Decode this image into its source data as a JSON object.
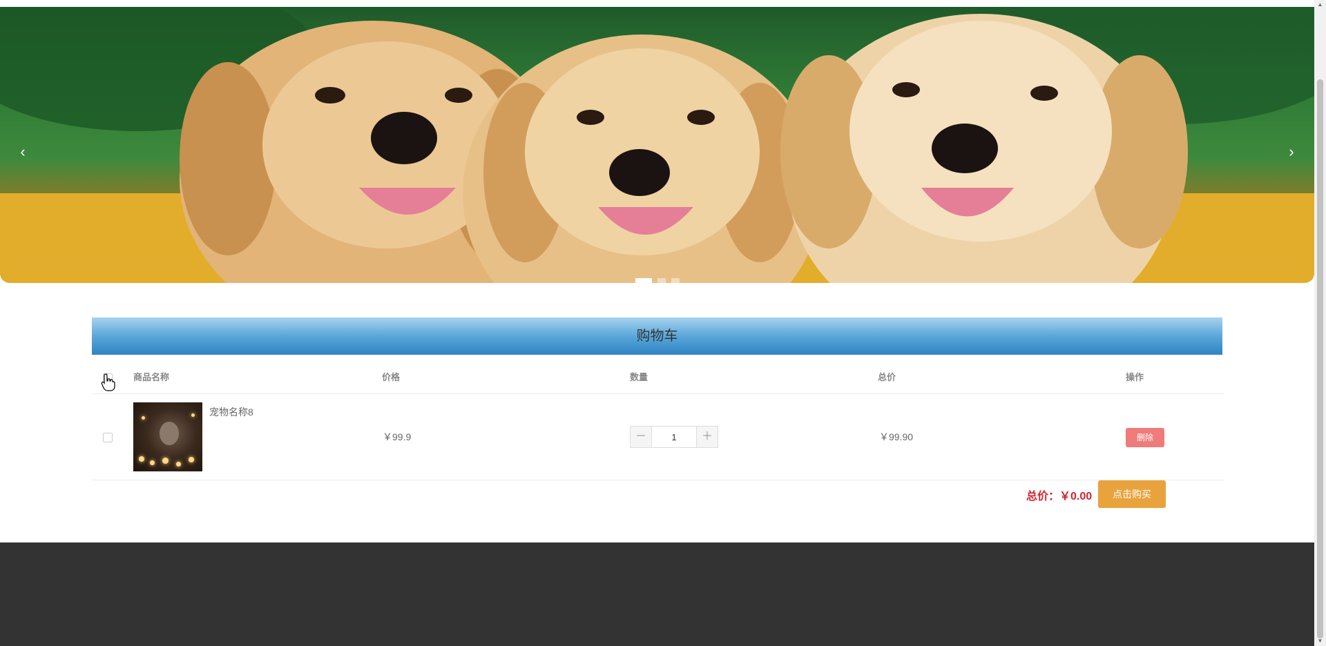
{
  "carousel": {
    "prev_icon": "chevron-left-icon",
    "next_icon": "chevron-right-icon",
    "prev_glyph": "‹",
    "next_glyph": "›",
    "slide_count": 3,
    "active_slide": 1
  },
  "cart": {
    "title": "购物车",
    "headers": {
      "name": "商品名称",
      "price": "价格",
      "quantity": "数量",
      "subtotal": "总价",
      "action": "操作"
    },
    "items": [
      {
        "name": "宠物名称8",
        "price": "￥99.9",
        "quantity": "1",
        "subtotal": "￥99.90",
        "delete_label": "删除",
        "checked": false
      }
    ],
    "minus_glyph": "－",
    "plus_glyph": "＋",
    "total_text": "总价：￥0.00",
    "buy_label": "点击购买"
  },
  "colors": {
    "title_bar": "#2f83c3",
    "delete": "#f07b7b",
    "buy": "#e8a33d",
    "total": "#d4232f",
    "footer": "#333333"
  }
}
